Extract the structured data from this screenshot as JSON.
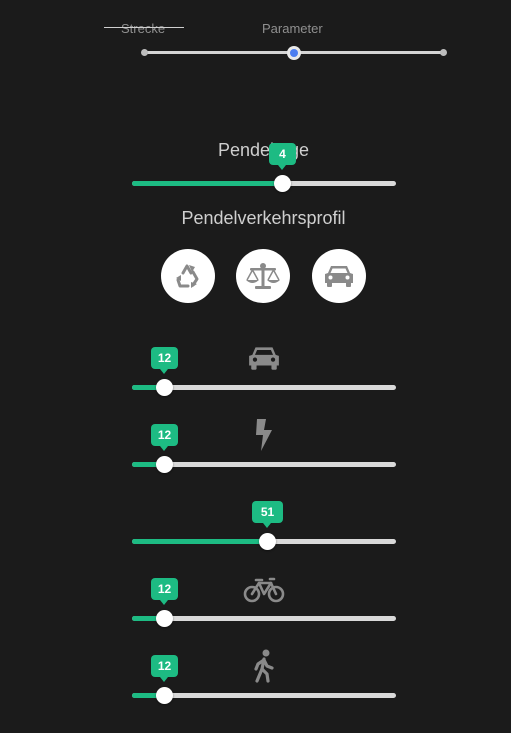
{
  "steps": {
    "items": [
      {
        "label": "Strecke",
        "done": true
      },
      {
        "label": "Parameter",
        "current": true
      }
    ]
  },
  "pendeltage": {
    "title": "Pendeltage",
    "value": "4",
    "fraction": 0.57
  },
  "profile": {
    "title": "Pendelverkehrsprofil",
    "options": [
      {
        "icon": "recycle-icon"
      },
      {
        "icon": "balance-scale-icon"
      },
      {
        "icon": "car-icon"
      }
    ]
  },
  "modes": [
    {
      "icon": "car-icon",
      "value": "12",
      "fraction": 0.12
    },
    {
      "icon": "lightning-icon",
      "value": "12",
      "fraction": 0.12
    },
    {
      "icon": "",
      "value": "51",
      "fraction": 0.51
    },
    {
      "icon": "bicycle-icon",
      "value": "12",
      "fraction": 0.12
    },
    {
      "icon": "walking-person-icon",
      "value": "12",
      "fraction": 0.12
    }
  ],
  "colors": {
    "background": "#1b1b1b",
    "accent": "#1dbb83",
    "track": "#d9d9d9",
    "step_active": "#4c7df0",
    "icon_gray": "#8a8a8a"
  }
}
